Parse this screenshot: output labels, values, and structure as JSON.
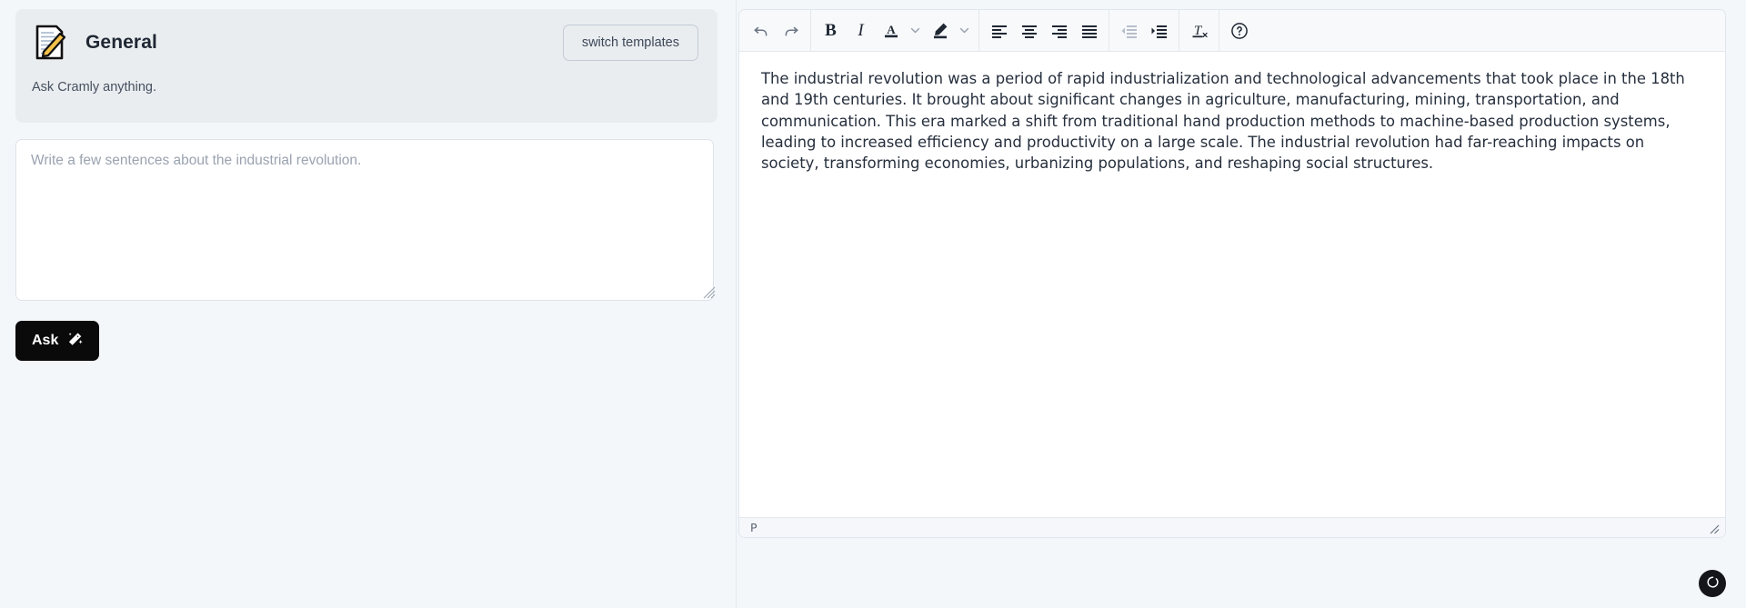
{
  "template": {
    "icon": "memo-pencil-icon",
    "title": "General",
    "subtitle": "Ask Cramly anything.",
    "switch_label": "switch templates"
  },
  "prompt": {
    "placeholder": "Write a few sentences about the industrial revolution.",
    "value": "",
    "resize_handle": "textarea-resize-handle"
  },
  "ask_button": {
    "label": "Ask",
    "icon": "magic-wand-icon"
  },
  "toolbar": {
    "groups": [
      {
        "name": "history",
        "items": [
          {
            "name": "undo-button",
            "icon": "undo-icon",
            "title": "Undo",
            "disabled": false
          },
          {
            "name": "redo-button",
            "icon": "redo-icon",
            "title": "Redo",
            "disabled": false
          }
        ]
      },
      {
        "name": "formatting",
        "items": [
          {
            "name": "bold-button",
            "icon": "bold-icon",
            "title": "Bold",
            "label": "B",
            "disabled": false
          },
          {
            "name": "italic-button",
            "icon": "italic-icon",
            "title": "Italic",
            "label": "I",
            "disabled": false
          },
          {
            "name": "text-color-button",
            "icon": "text-color-icon",
            "title": "Text color",
            "label": "A",
            "disabled": false
          },
          {
            "name": "text-color-dropdown",
            "icon": "chevron-down-icon",
            "title": "Text color options",
            "disabled": false
          },
          {
            "name": "highlight-button",
            "icon": "highlighter-pen-icon",
            "title": "Highlight",
            "disabled": false
          },
          {
            "name": "highlight-dropdown",
            "icon": "chevron-down-icon",
            "title": "Highlight options",
            "disabled": false
          }
        ]
      },
      {
        "name": "alignment",
        "items": [
          {
            "name": "align-left-button",
            "icon": "align-left-icon",
            "title": "Align left",
            "disabled": false
          },
          {
            "name": "align-center-button",
            "icon": "align-center-icon",
            "title": "Align center",
            "disabled": false
          },
          {
            "name": "align-right-button",
            "icon": "align-right-icon",
            "title": "Align right",
            "disabled": false
          },
          {
            "name": "align-justify-button",
            "icon": "align-justify-icon",
            "title": "Justify",
            "disabled": false
          }
        ]
      },
      {
        "name": "indentation",
        "items": [
          {
            "name": "outdent-button",
            "icon": "outdent-icon",
            "title": "Decrease indent",
            "disabled": true
          },
          {
            "name": "indent-button",
            "icon": "indent-icon",
            "title": "Increase indent",
            "disabled": false
          }
        ]
      },
      {
        "name": "clear",
        "items": [
          {
            "name": "clear-formatting-button",
            "icon": "clear-formatting-icon",
            "title": "Clear formatting",
            "disabled": false
          }
        ]
      },
      {
        "name": "help",
        "items": [
          {
            "name": "help-button",
            "icon": "help-circle-icon",
            "title": "Help",
            "disabled": false
          }
        ]
      }
    ]
  },
  "editor": {
    "content": "The industrial revolution was a period of rapid industrialization and technological advancements that took place in the 18th and 19th centuries. It brought about significant changes in agriculture, manufacturing, mining, transportation, and communication. This era marked a shift from traditional hand production methods to machine-based production systems, leading to increased efficiency and productivity on a large scale. The industrial revolution had far-reaching impacts on society, transforming economies, urbanizing populations, and reshaping social structures.",
    "status_path": "P",
    "resize_handle": "editor-resize-handle"
  },
  "fab": {
    "name": "support-widget-button",
    "icon": "loading-ring-icon"
  },
  "colors": {
    "page_background": "#f4f7fa",
    "header_panel": "#eaedf0",
    "toolbar_background": "#f7f9fb",
    "editor_background": "#ffffff",
    "ask_button_background": "#0a0a0a",
    "border": "#e0e6ed",
    "text_primary": "#1f2733",
    "text_muted": "#46505f",
    "icon_accent_yellow": "#f5c249"
  }
}
